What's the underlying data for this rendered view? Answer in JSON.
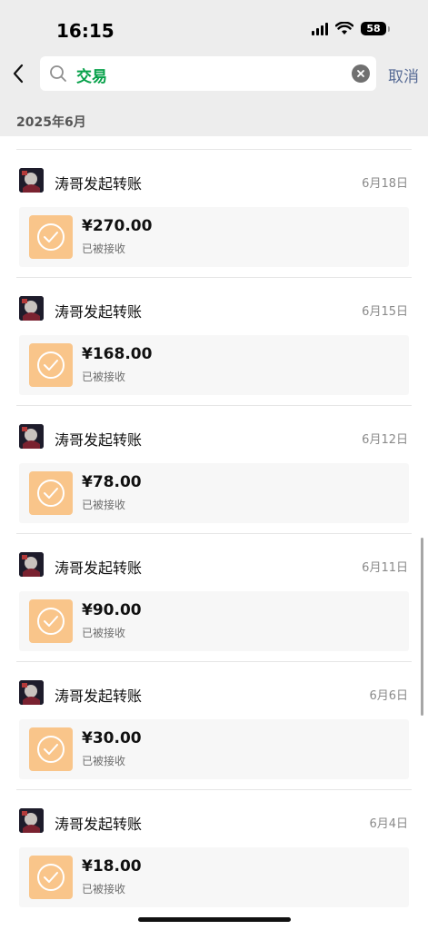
{
  "status_bar": {
    "time": "16:15",
    "battery": "58"
  },
  "search": {
    "query": "交易"
  },
  "cancel_label": "取消",
  "month_label": "2025年6月",
  "colors": {
    "accent_green": "#07a14a",
    "link_blue": "#576b95",
    "icon_orange": "#f9c58a"
  },
  "entries": [
    {
      "sender": "涛哥发起转账",
      "date": "6月18日",
      "amount": "¥270.00",
      "status": "已被接收"
    },
    {
      "sender": "涛哥发起转账",
      "date": "6月15日",
      "amount": "¥168.00",
      "status": "已被接收"
    },
    {
      "sender": "涛哥发起转账",
      "date": "6月12日",
      "amount": "¥78.00",
      "status": "已被接收"
    },
    {
      "sender": "涛哥发起转账",
      "date": "6月11日",
      "amount": "¥90.00",
      "status": "已被接收"
    },
    {
      "sender": "涛哥发起转账",
      "date": "6月6日",
      "amount": "¥30.00",
      "status": "已被接收"
    },
    {
      "sender": "涛哥发起转账",
      "date": "6月4日",
      "amount": "¥18.00",
      "status": "已被接收"
    }
  ]
}
